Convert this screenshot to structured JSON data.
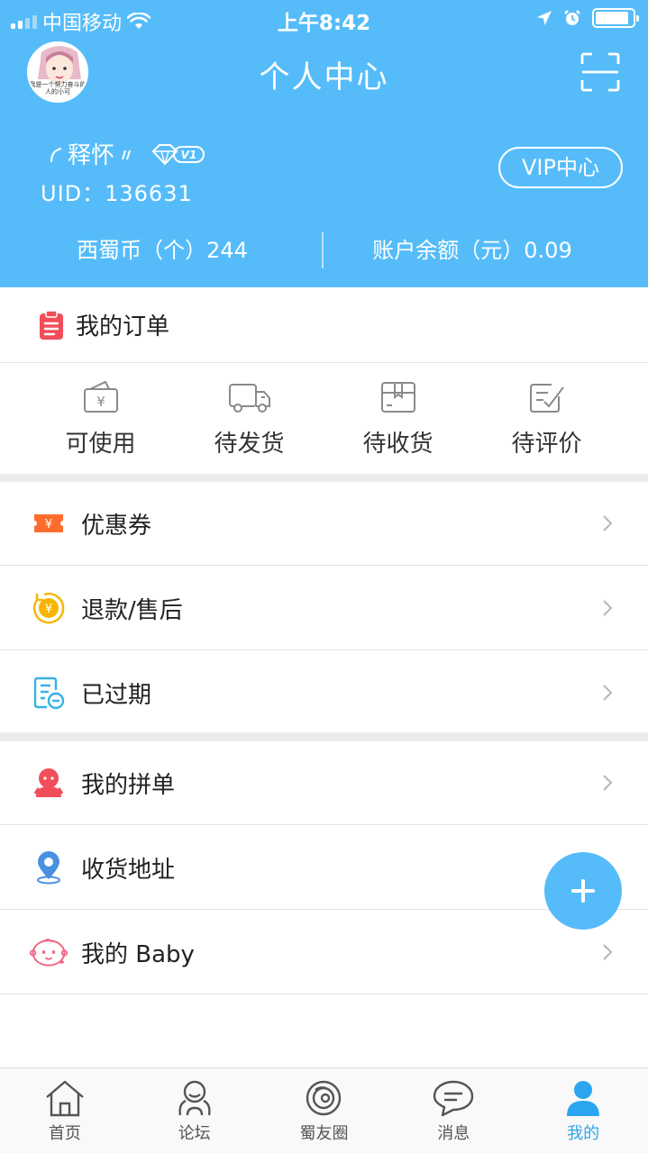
{
  "status_bar": {
    "carrier": "中国移动",
    "time": "上午8:42",
    "battery_level": 0.9
  },
  "header": {
    "title": "个人中心",
    "avatar_caption": "我是一个努力奋斗的人的小可",
    "username": "释怀",
    "vip_level": "V1",
    "uid": "UID：136631",
    "vip_center_label": "VIP中心",
    "stats": [
      {
        "label": "西蜀币（个）244"
      },
      {
        "label": "账户余额（元）0.09"
      }
    ]
  },
  "orders": {
    "title": "我的订单",
    "items": [
      {
        "label": "可使用",
        "icon": "voucher-icon"
      },
      {
        "label": "待发货",
        "icon": "truck-icon"
      },
      {
        "label": "待收货",
        "icon": "package-icon"
      },
      {
        "label": "待评价",
        "icon": "review-icon"
      }
    ]
  },
  "menu": {
    "coupon": "优惠券",
    "refund": "退款/售后",
    "expired": "已过期",
    "group_buy": "我的拼单",
    "address": "收货地址",
    "baby": "我的 Baby"
  },
  "fab_label": "+",
  "tabs": [
    {
      "label": "首页",
      "icon": "home-icon"
    },
    {
      "label": "论坛",
      "icon": "forum-icon"
    },
    {
      "label": "蜀友圈",
      "icon": "circle-icon"
    },
    {
      "label": "消息",
      "icon": "message-icon"
    },
    {
      "label": "我的",
      "icon": "profile-icon",
      "active": true
    }
  ],
  "colors": {
    "primary": "#56bcf9",
    "active_tab": "#2ba5f0",
    "coupon": "#ff6d2e",
    "refund": "#f7b500",
    "expired": "#36b1e8",
    "group": "#f24d5a",
    "address": "#4a90e2",
    "baby": "#f06a86"
  }
}
